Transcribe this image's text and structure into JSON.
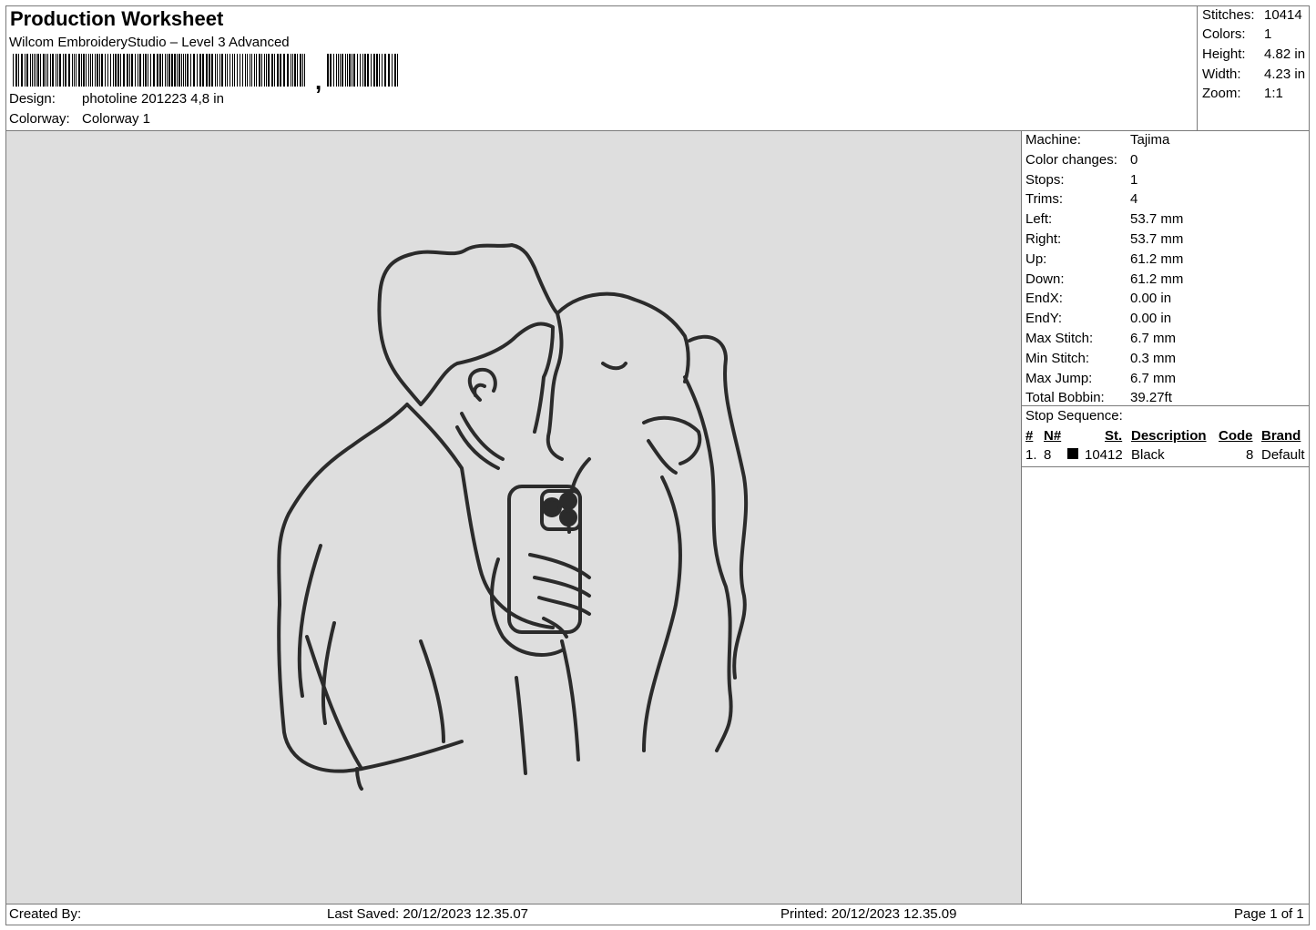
{
  "header": {
    "title": "Production Worksheet",
    "software": "Wilcom EmbroideryStudio – Level 3 Advanced",
    "design_label": "Design:",
    "design_value": "photoline 201223 4,8 in",
    "colorway_label": "Colorway:",
    "colorway_value": "Colorway 1"
  },
  "summary": {
    "stitches_label": "Stitches:",
    "stitches_value": "10414",
    "colors_label": "Colors:",
    "colors_value": "1",
    "height_label": "Height:",
    "height_value": "4.82 in",
    "width_label": "Width:",
    "width_value": "4.23 in",
    "zoom_label": "Zoom:",
    "zoom_value": "1:1"
  },
  "machine_info": [
    {
      "label": "Machine:",
      "value": "Tajima"
    },
    {
      "label": "Color changes:",
      "value": "0"
    },
    {
      "label": "Stops:",
      "value": "1"
    },
    {
      "label": "Trims:",
      "value": "4"
    },
    {
      "label": "Left:",
      "value": "53.7 mm"
    },
    {
      "label": "Right:",
      "value": "53.7 mm"
    },
    {
      "label": "Up:",
      "value": "61.2 mm"
    },
    {
      "label": "Down:",
      "value": "61.2 mm"
    },
    {
      "label": "EndX:",
      "value": "0.00 in"
    },
    {
      "label": "EndY:",
      "value": "0.00 in"
    },
    {
      "label": "Max Stitch:",
      "value": "6.7 mm"
    },
    {
      "label": "Min Stitch:",
      "value": "0.3 mm"
    },
    {
      "label": "Max Jump:",
      "value": "6.7 mm"
    },
    {
      "label": "Total Bobbin:",
      "value": "39.27ft"
    }
  ],
  "stop_sequence": {
    "title": "Stop Sequence:",
    "columns": [
      "#",
      "N#",
      "St.",
      "Description",
      "Code",
      "Brand"
    ],
    "rows": [
      {
        "num": "1.",
        "needle": "8",
        "stitches": "10412",
        "description": "Black",
        "code": "8",
        "brand": "Default",
        "color": "#000000"
      }
    ]
  },
  "footer": {
    "created_by": "Created By:",
    "last_saved": "Last Saved: 20/12/2023 12.35.07",
    "printed": "Printed: 20/12/2023 12.35.09",
    "page": "Page 1 of 1"
  },
  "colors": {
    "canvas_bg": "#dedede",
    "thread": "#2b2b2b",
    "border": "#7a7a7a"
  }
}
